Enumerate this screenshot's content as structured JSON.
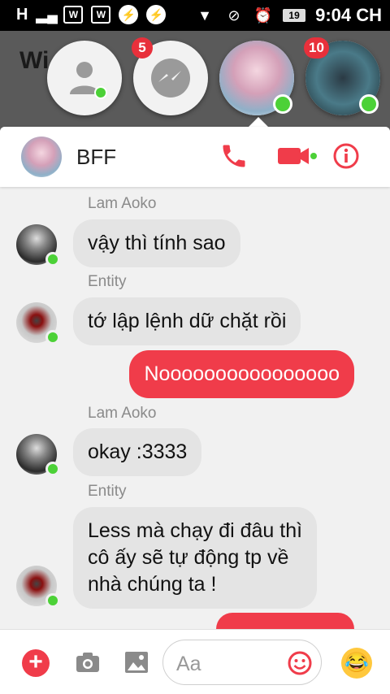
{
  "status_bar": {
    "left_icons": [
      "H",
      "signal-icon",
      "w-icon",
      "w-icon",
      "messenger-icon",
      "messenger-icon"
    ],
    "network_label": "H",
    "time": "9:04 CH",
    "battery": "19"
  },
  "background_app": {
    "title_fragment": "Wi"
  },
  "chat_heads": [
    {
      "name": "contact-head",
      "badge": "",
      "online": true
    },
    {
      "name": "messenger-head",
      "badge": "5",
      "online": false
    },
    {
      "name": "bff-group-head",
      "badge": "",
      "online": true
    },
    {
      "name": "anime-head",
      "badge": "10",
      "online": true
    }
  ],
  "header": {
    "title": "BFF"
  },
  "messages": [
    {
      "sender": "Lam Aoko",
      "text": "vậy thì tính sao",
      "direction": "in"
    },
    {
      "sender": "Entity",
      "text": "tớ lập lệnh dữ chặt rồi",
      "direction": "in"
    },
    {
      "sender": "",
      "text": "Noooooooooooooooo",
      "direction": "out"
    },
    {
      "sender": "Lam Aoko",
      "text": "okay :3333",
      "direction": "in"
    },
    {
      "sender": "Entity",
      "text_lines": [
        "Less mà chạy đi đâu thì",
        "cô ấy sẽ tự động tp về",
        "nhà chúng ta !"
      ],
      "direction": "in"
    }
  ],
  "composer": {
    "placeholder": "Aa"
  },
  "colors": {
    "accent": "#f03c4a",
    "online": "#4cd137",
    "incoming_bubble": "#e4e4e4"
  }
}
